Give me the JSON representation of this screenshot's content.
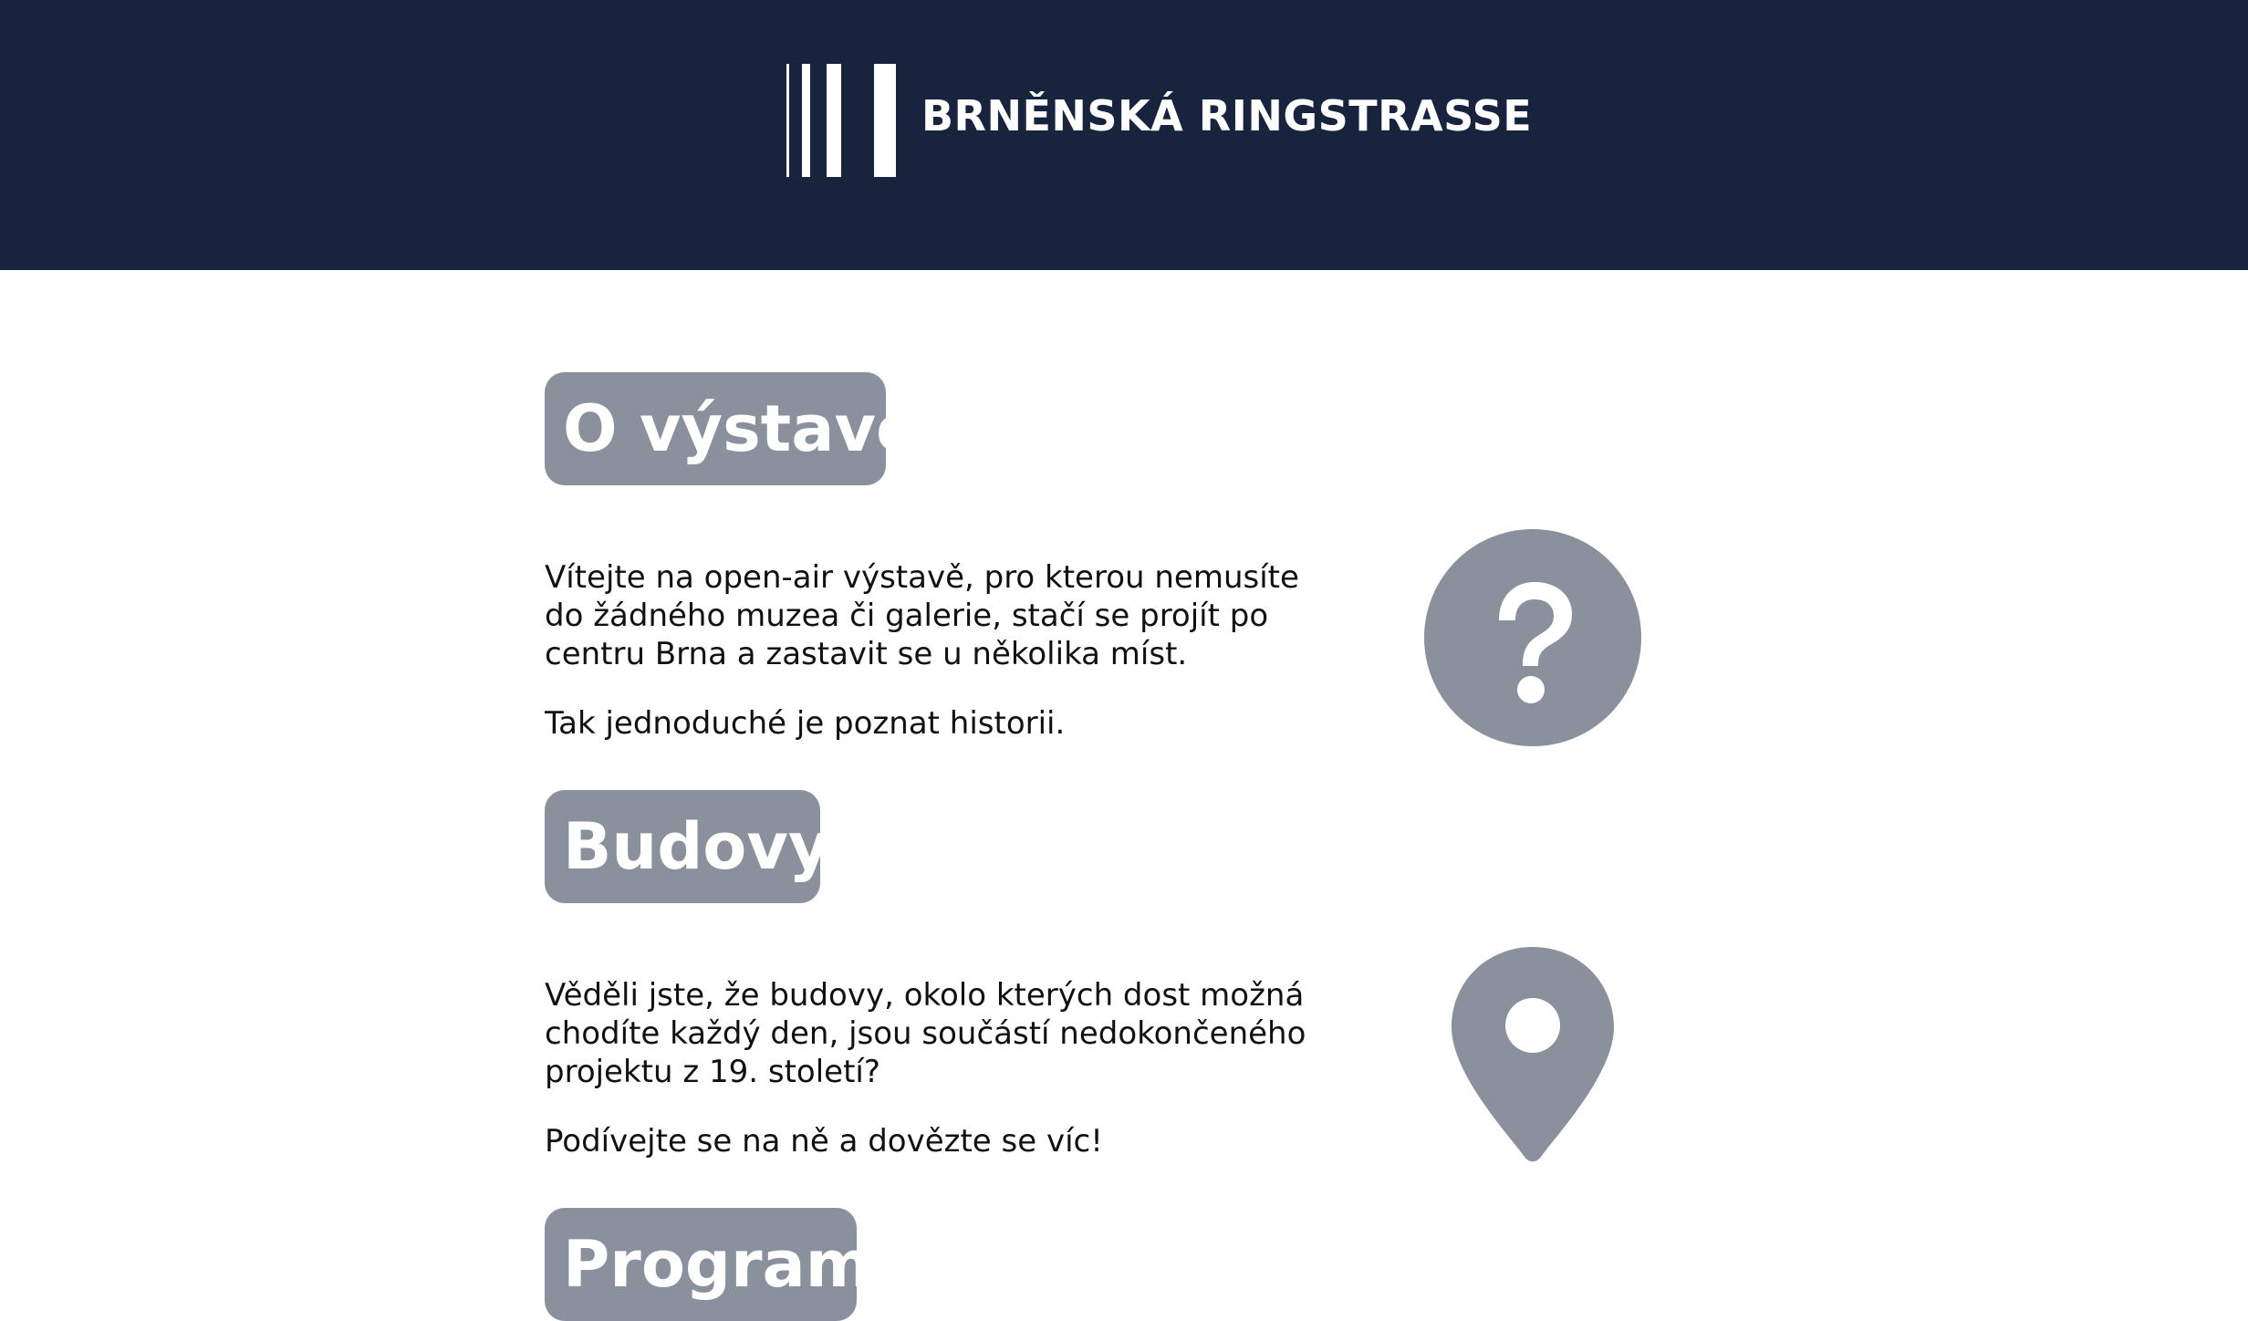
{
  "site": {
    "title": "BRNĚNSKÁ RINGSTRASSE"
  },
  "colors": {
    "header_bg": "#18243e",
    "accent_gray": "#8a919c",
    "text": "#111111"
  },
  "sections": [
    {
      "heading": "O výstavě",
      "paragraphs": [
        "Vítejte na open-air výstavě, pro kterou nemusíte do žádného muzea či galerie, stačí se projít po centru Brna a zastavit se u několika míst.",
        "Tak jednoduché je poznat historii."
      ],
      "icon": "question-mark-icon"
    },
    {
      "heading": "Budovy",
      "paragraphs": [
        "Věděli jste, že budovy, okolo kterých dost možná chodíte každý den, jsou součástí nedokončeného projektu z 19. století?",
        "Podívejte se na ně a dovězte se víc!"
      ],
      "icon": "map-pin-icon"
    },
    {
      "heading": "Program",
      "paragraphs": [],
      "icon": ""
    }
  ]
}
